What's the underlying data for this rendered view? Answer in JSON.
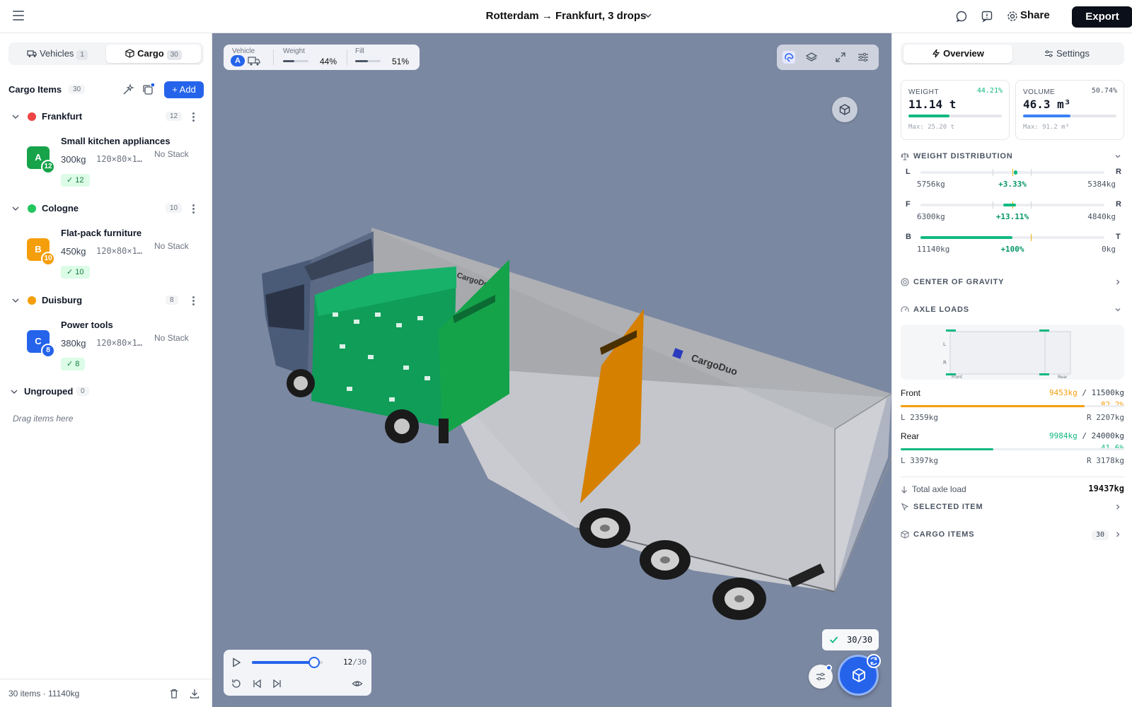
{
  "header": {
    "title": "Rotterdam → Frankfurt, 3 drops",
    "share_label": "Share",
    "export_label": "Export"
  },
  "left": {
    "tabs": [
      {
        "label": "Vehicles",
        "count": "1",
        "active": false
      },
      {
        "label": "Cargo",
        "count": "30",
        "active": true
      }
    ],
    "cargo_items_title": "Cargo Items",
    "cargo_items_count": "30",
    "add_label": "+ Add",
    "groups": [
      {
        "name": "Frankfurt",
        "count": "12",
        "color": "#ef4444",
        "item": {
          "name": "Small kitchen appliances",
          "letter": "A",
          "badge": "12",
          "weight": "300kg",
          "dims": "120×80×1…",
          "stack": "No Stack",
          "check": "✓ 12",
          "color": "#16a34a"
        }
      },
      {
        "name": "Cologne",
        "count": "10",
        "color": "#22c55e",
        "item": {
          "name": "Flat-pack furniture",
          "letter": "B",
          "badge": "10",
          "weight": "450kg",
          "dims": "120×80×1…",
          "stack": "No Stack",
          "check": "✓ 10",
          "color": "#f59e0b"
        }
      },
      {
        "name": "Duisburg",
        "count": "8",
        "color": "#f59e0b",
        "item": {
          "name": "Power tools",
          "letter": "C",
          "badge": "8",
          "weight": "380kg",
          "dims": "120×80×1…",
          "stack": "No Stack",
          "check": "✓ 8",
          "color": "#2563eb"
        }
      }
    ],
    "ungrouped": {
      "name": "Ungrouped",
      "count": "0",
      "hint": "Drag items here"
    },
    "footer": {
      "summary": "30 items · 11140kg"
    }
  },
  "viewport": {
    "vehicle_label": "Vehicle",
    "vehicle_letter": "A",
    "weight_label": "Weight",
    "weight_pct": "44%",
    "weight_fraction": 0.44,
    "fill_label": "Fill",
    "fill_pct": "51%",
    "fill_fraction": 0.51,
    "playback": {
      "step": "12",
      "total": "/30",
      "fraction": 0.4
    },
    "done_label": "30/30",
    "brand_text": "CargoDuo"
  },
  "right": {
    "tabs": [
      {
        "label": "Overview",
        "active": true
      },
      {
        "label": "Settings",
        "active": false
      }
    ],
    "weight": {
      "label": "WEIGHT",
      "pct": "44.21%",
      "value": "11.14 t",
      "max": "Max: 25.20 t",
      "fraction": 0.4421,
      "color": "#10b981"
    },
    "volume": {
      "label": "VOLUME",
      "pct": "50.74%",
      "value": "46.3 m³",
      "max": "Max: 91.2 m³",
      "fraction": 0.5074,
      "color": "#3b82f6"
    },
    "weight_distribution": {
      "title": "WEIGHT DISTRIBUTION",
      "rows": [
        {
          "left_letter": "L",
          "right_letter": "R",
          "left_value": "5756kg",
          "delta": "+3.33%",
          "right_value": "5384kg",
          "position": 0.517
        },
        {
          "left_letter": "F",
          "right_letter": "R",
          "left_value": "6300kg",
          "delta": "+13.11%",
          "right_value": "4840kg",
          "position": 0.466
        },
        {
          "left_letter": "B",
          "right_letter": "T",
          "left_value": "11140kg",
          "delta": "+100%",
          "right_value": "0kg",
          "position": 0.5
        }
      ]
    },
    "center_of_gravity": {
      "title": "CENTER OF GRAVITY"
    },
    "axle_loads": {
      "title": "AXLE LOADS",
      "diagram_labels": {
        "left": "L",
        "right": "R",
        "front": "Front",
        "rear": "Rear"
      },
      "front": {
        "name": "Front",
        "load": "9453kg",
        "limit": "/ 11500kg",
        "pct": "82.2%",
        "fraction": 0.822,
        "color": "#f59e0b",
        "left": "L 2359kg",
        "right": "R 2207kg"
      },
      "rear": {
        "name": "Rear",
        "load": "9984kg",
        "limit": "/ 24000kg",
        "pct": "41.6%",
        "fraction": 0.416,
        "color": "#10b981",
        "left": "L 3397kg",
        "right": "R 3178kg"
      },
      "total_label": "Total axle load",
      "total_value": "19437kg"
    },
    "selected_item": {
      "title": "SELECTED ITEM"
    },
    "cargo_items": {
      "title": "CARGO ITEMS",
      "count": "30"
    }
  }
}
